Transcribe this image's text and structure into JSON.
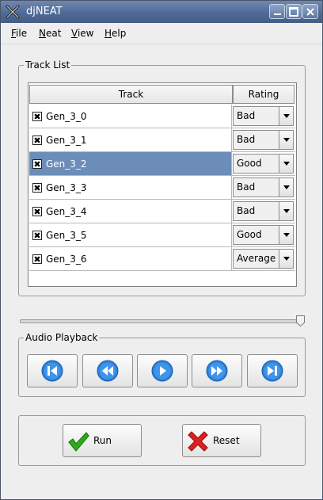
{
  "window": {
    "title": "djNEAT"
  },
  "menu": {
    "file": {
      "mnemonic": "F",
      "rest": "ile"
    },
    "neat": {
      "mnemonic": "N",
      "rest": "eat"
    },
    "view": {
      "mnemonic": "V",
      "rest": "iew"
    },
    "help": {
      "mnemonic": "H",
      "rest": "elp"
    }
  },
  "track_list": {
    "legend": "Track List",
    "columns": {
      "track": "Track",
      "rating": "Rating"
    },
    "rows": [
      {
        "name": "Gen_3_0",
        "checked": true,
        "rating": "Bad",
        "selected": false
      },
      {
        "name": "Gen_3_1",
        "checked": true,
        "rating": "Bad",
        "selected": false
      },
      {
        "name": "Gen_3_2",
        "checked": true,
        "rating": "Good",
        "selected": true
      },
      {
        "name": "Gen_3_3",
        "checked": true,
        "rating": "Bad",
        "selected": false
      },
      {
        "name": "Gen_3_4",
        "checked": true,
        "rating": "Bad",
        "selected": false
      },
      {
        "name": "Gen_3_5",
        "checked": true,
        "rating": "Good",
        "selected": false
      },
      {
        "name": "Gen_3_6",
        "checked": true,
        "rating": "Average",
        "selected": false
      }
    ]
  },
  "slider": {
    "value_fraction": 1.0
  },
  "playback": {
    "legend": "Audio Playback",
    "buttons": [
      "skip-to-start-icon",
      "rewind-icon",
      "play-icon",
      "fast-forward-icon",
      "skip-to-end-icon"
    ]
  },
  "actions": {
    "run_label": "Run",
    "reset_label": "Reset"
  },
  "colors": {
    "titlebar": "#4f6a96",
    "selection": "#6b8db8",
    "icon_blue": "#2e7fd8",
    "run_green": "#2faa1e",
    "reset_red": "#e02020"
  }
}
